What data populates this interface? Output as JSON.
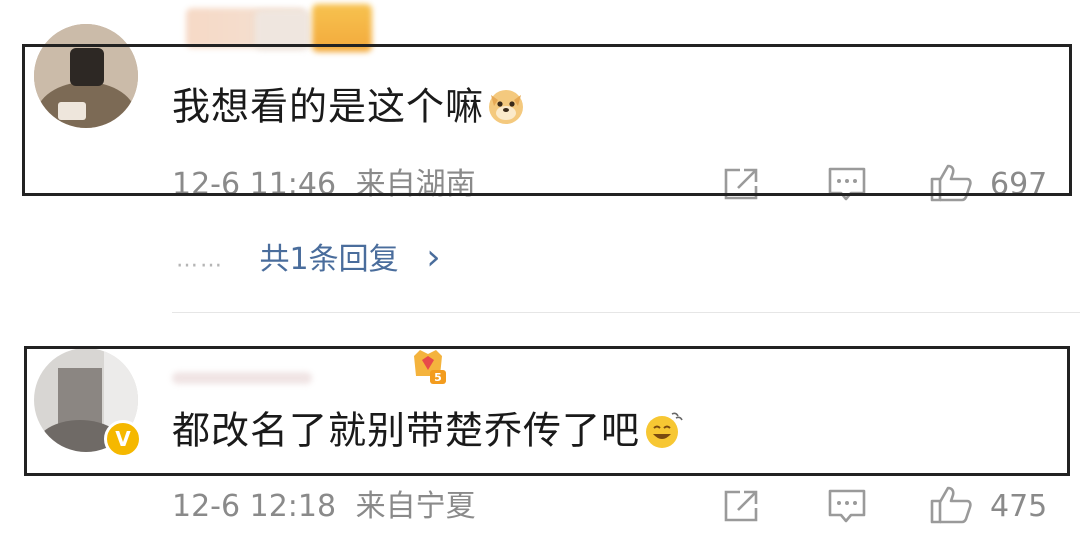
{
  "comments": [
    {
      "text": "我想看的是这个嘛",
      "emoji": "doge-emoji",
      "time": "12-6 11:46",
      "location": "来自湖南",
      "likes": "697",
      "reply_summary": {
        "dots": "……",
        "text": "共1条回复",
        "chevron": "›"
      }
    },
    {
      "text": "都改名了就别带楚乔传了吧",
      "emoji": "smile-emoji",
      "time": "12-6 12:18",
      "location": "来自宁夏",
      "likes": "475",
      "verified_badge": "V"
    }
  ],
  "icons": {
    "share": "share-icon",
    "comment": "comment-icon",
    "like": "thumbs-up-icon"
  },
  "colors": {
    "text": "#1a1a1a",
    "meta": "#8a8a8a",
    "link": "#4a6d9c",
    "box": "#222222",
    "badge": "#f5b800"
  }
}
